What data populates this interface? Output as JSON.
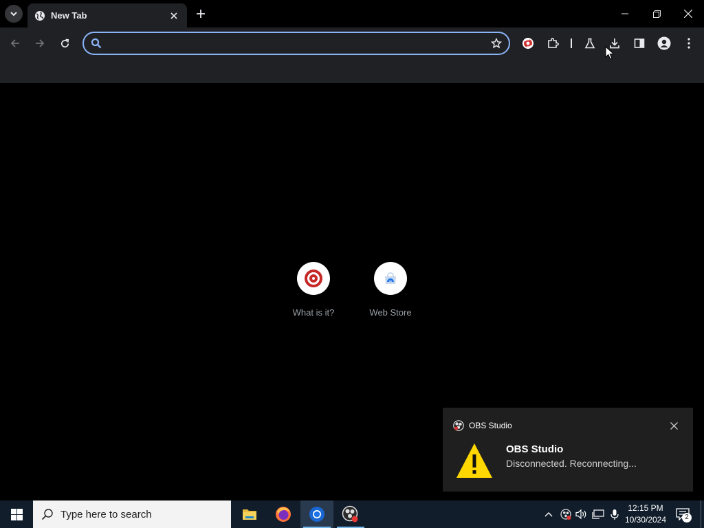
{
  "browser": {
    "tab": {
      "title": "New Tab",
      "close_label": "✕"
    },
    "newtab_label": "+",
    "window_controls": [
      "minimize",
      "restore",
      "close"
    ],
    "omnibox": {
      "placeholder": "",
      "value": ""
    },
    "toolbar_icons": [
      "back-icon",
      "forward-icon",
      "reload-icon",
      "search-icon",
      "star-icon",
      "obs-extension-icon",
      "puzzle-icon",
      "labs-flask-icon",
      "download-icon",
      "side-panel-icon",
      "profile-icon",
      "kebab-menu-icon"
    ]
  },
  "shortcuts": [
    {
      "label": "What is it?",
      "icon": "red-spiral-logo"
    },
    {
      "label": "Web Store",
      "icon": "web-store-icon"
    }
  ],
  "toast": {
    "app_name": "OBS Studio",
    "title": "OBS Studio",
    "message": "Disconnected. Reconnecting...",
    "icon": "warning-triangle-icon"
  },
  "taskbar": {
    "search_placeholder": "Type here to search",
    "apps": [
      "file-explorer-icon",
      "firefox-icon",
      "chrome-icon",
      "obs-icon"
    ],
    "tray_icons": [
      "chevron-up-icon",
      "obs-tray-icon",
      "speaker-icon",
      "network-icon",
      "microphone-icon"
    ],
    "time": "12:15 PM",
    "date": "10/30/2024",
    "notification_count": "2"
  },
  "colors": {
    "accent_blue": "#8ab4f8",
    "toolbar_bg": "#202124",
    "taskbar_bg": "#111d2b",
    "warning_yellow": "#ffd700",
    "obs_red": "#d32f2f"
  }
}
